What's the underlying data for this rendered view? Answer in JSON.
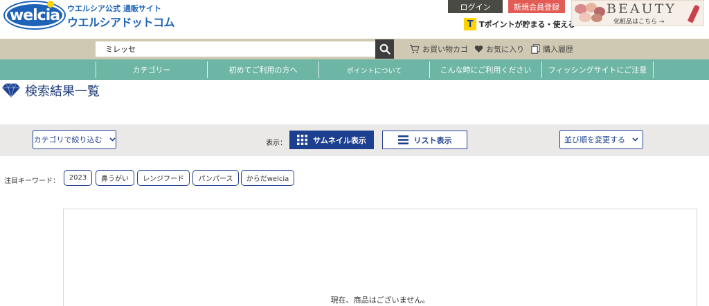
{
  "header": {
    "logo_text": "welcia",
    "tagline": "ウエルシア公式 通販サイト",
    "site_name": "ウエルシアドットコム",
    "login_label": "ログイン",
    "register_label": "新規会員登録",
    "tpoint_icon_text": "T",
    "tpoint_text": "Tポイントが貯まる・使える",
    "banner": {
      "title": "BEAUTY",
      "subtitle": "化粧品はこちら →"
    }
  },
  "search": {
    "value": "ミレッセ",
    "placeholder": "",
    "cart_label": "お買い物カゴ",
    "favorites_label": "お気に入り",
    "history_label": "購入履歴"
  },
  "nav": {
    "items": [
      {
        "label": "カテゴリー"
      },
      {
        "label": "初めてご利用の方へ"
      },
      {
        "label": "ポイントについて"
      },
      {
        "label": "こんな時にご利用ください"
      },
      {
        "label": "フィッシングサイトにご注意"
      }
    ]
  },
  "page": {
    "title": "検索結果一覧"
  },
  "toolbar": {
    "category_filter": "カテゴリで絞り込む",
    "display_label": "表示：",
    "thumbnail_view": "サムネイル表示",
    "list_view": "リスト表示",
    "sort_label": "並び順を変更する"
  },
  "keywords": {
    "label": "注目キーワード：",
    "items": [
      "2023",
      "鼻うがい",
      "レンジフード",
      "パンパース",
      "からだwelcia"
    ]
  },
  "results": {
    "empty_message": "現在、商品はございません。"
  },
  "colors": {
    "brand_blue": "#1d64b9",
    "navy": "#1d3f8f",
    "nav_green": "#6db5a5",
    "search_beige": "#cfc9b4",
    "register_red": "#e35b55"
  }
}
